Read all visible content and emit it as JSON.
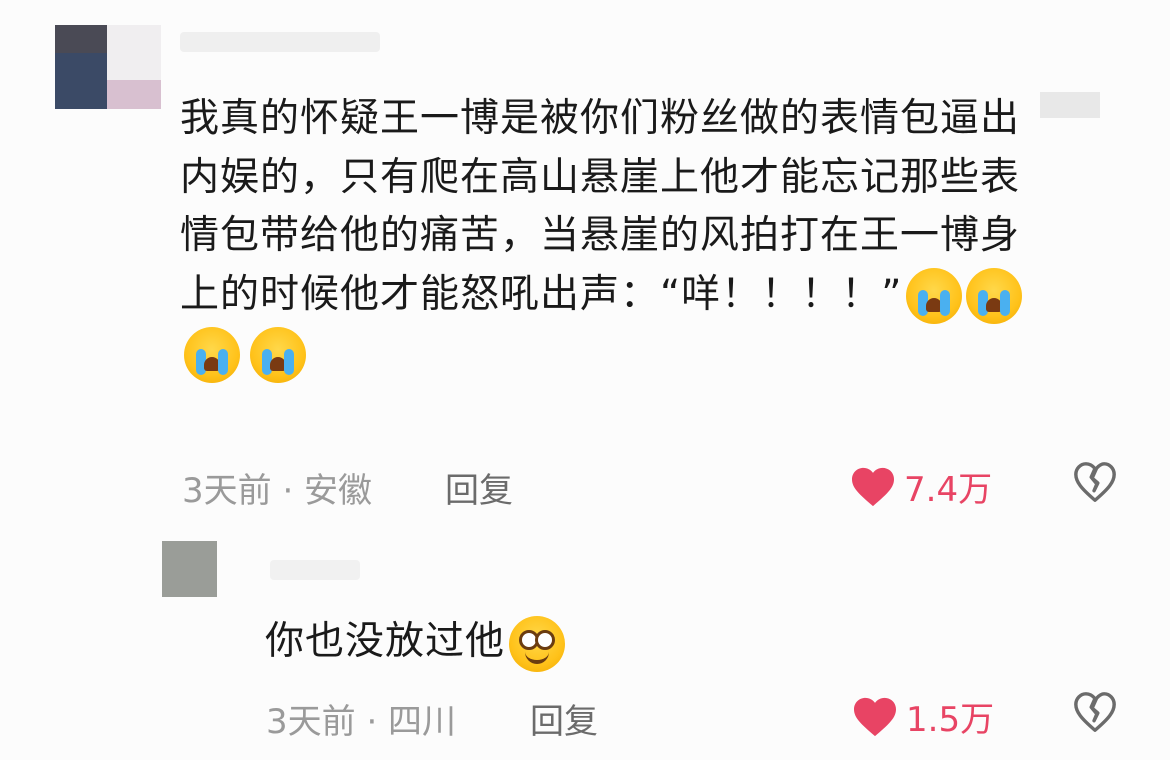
{
  "comments": [
    {
      "text_lines": [
        "我真的怀疑王一博是被你们粉丝做的表情包逼出",
        "内娱的，只有爬在高山悬崖上他才能忘记那些表",
        "情包带给他的痛苦，当悬崖的风拍打在王一博身",
        "上的时候他才能怒吼出声：“咩！！！！”"
      ],
      "emojis": [
        "crying-face",
        "crying-face",
        "crying-face",
        "crying-face"
      ],
      "time_location": "3天前 · 安徽",
      "reply_label": "回复",
      "likes": "7.4万"
    },
    {
      "text": "你也没放过他",
      "emojis": [
        "flushed-smile-face"
      ],
      "time_location": "3天前 · 四川",
      "reply_label": "回复",
      "likes": "1.5万"
    }
  ],
  "colors": {
    "like": "#e84464",
    "meta": "#9a9a9a",
    "text": "#1a1a1a"
  }
}
